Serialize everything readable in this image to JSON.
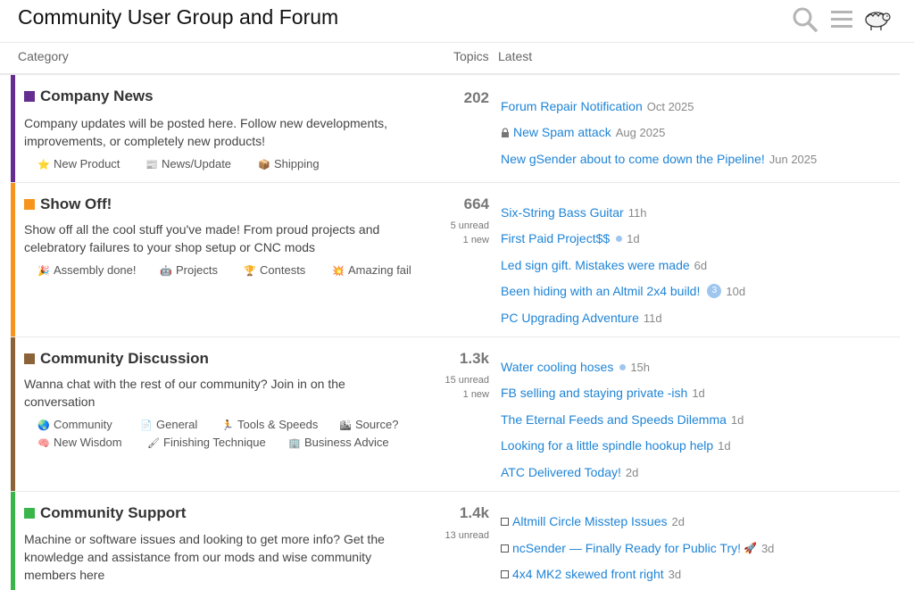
{
  "header": {
    "site_title": "Community User Group and Forum",
    "icons": [
      "search-icon",
      "hamburger-menu-icon",
      "avatar-icon"
    ]
  },
  "columns": {
    "category": "Category",
    "topics": "Topics",
    "latest": "Latest"
  },
  "colors": {
    "link": "#1f84d6",
    "company_news": "#652d90",
    "show_off": "#f7941d",
    "community_discussion": "#8c6238",
    "community_support": "#3ab54a"
  },
  "categories": [
    {
      "name": "Company News",
      "description": "Company updates will be posted here. Follow new developments, improvements, or completely new products!",
      "topics": "202",
      "subcategories": [
        {
          "label": "New Product",
          "icon": "star-icon"
        },
        {
          "label": "News/Update",
          "icon": "newspaper-icon"
        },
        {
          "label": "Shipping",
          "icon": "package-icon"
        }
      ],
      "latest": [
        {
          "title": "Forum Repair Notification",
          "age": "Oct 2025"
        },
        {
          "title": "New Spam attack",
          "age": "Aug 2025",
          "icon": "lock-icon"
        },
        {
          "title": "New gSender about to come down the Pipeline!",
          "age": "Jun 2025"
        }
      ]
    },
    {
      "name": "Show Off!",
      "description": "Show off all the cool stuff you've made! From proud projects and celebratory failures to your shop setup or CNC mods",
      "topics": "664",
      "unread": "5 unread",
      "new": "1 new",
      "subcategories": [
        {
          "label": "Assembly done!",
          "icon": "party-popper-icon"
        },
        {
          "label": "Projects",
          "icon": "robot-icon"
        },
        {
          "label": "Contests",
          "icon": "trophy-icon"
        },
        {
          "label": "Amazing fail",
          "icon": "explosion-icon"
        }
      ],
      "latest": [
        {
          "title": "Six-String Bass Guitar",
          "age": "11h"
        },
        {
          "title": "First Paid Project$$",
          "age": "1d",
          "dot": true
        },
        {
          "title": "Led sign gift. Mistakes were made",
          "age": "6d"
        },
        {
          "title": "Been hiding with an Altmil 2x4 build!",
          "age": "10d",
          "count": "3"
        },
        {
          "title": "PC Upgrading Adventure",
          "age": "11d"
        }
      ]
    },
    {
      "name": "Community Discussion",
      "description": "Wanna chat with the rest of our community? Join in on the conversation",
      "topics": "1.3k",
      "unread": "15 unread",
      "new": "1 new",
      "subcategories": [
        {
          "label": "Community",
          "icon": "globe-icon"
        },
        {
          "label": "General",
          "icon": "document-icon"
        },
        {
          "label": "Tools & Speeds",
          "icon": "runner-icon"
        },
        {
          "label": "Source?",
          "icon": "building-icon"
        },
        {
          "label": "New Wisdom",
          "icon": "brain-icon"
        },
        {
          "label": "Finishing Technique",
          "icon": "paintbrush-icon"
        },
        {
          "label": "Business Advice",
          "icon": "office-building-icon"
        }
      ],
      "latest": [
        {
          "title": "Water cooling hoses",
          "age": "15h",
          "dot": true
        },
        {
          "title": "FB selling and staying private -ish",
          "age": "1d"
        },
        {
          "title": "The Eternal Feeds and Speeds Dilemma",
          "age": "1d"
        },
        {
          "title": "Looking for a little spindle hookup help",
          "age": "1d"
        },
        {
          "title": "ATC Delivered Today!",
          "age": "2d"
        }
      ]
    },
    {
      "name": "Community Support",
      "description": "Machine or software issues and looking to get more info? Get the knowledge and assistance from our mods and wise community members here",
      "topics": "1.4k",
      "unread": "13 unread",
      "latest": [
        {
          "title": "Altmill Circle Misstep Issues",
          "age": "2d",
          "icon": "checkbox-icon"
        },
        {
          "title": "ncSender — Finally Ready for Public Try!",
          "age": "3d",
          "icon": "checkbox-icon",
          "emoji": "🚀"
        },
        {
          "title": "4x4 MK2 skewed front right",
          "age": "3d",
          "icon": "checkbox-icon"
        }
      ]
    }
  ]
}
